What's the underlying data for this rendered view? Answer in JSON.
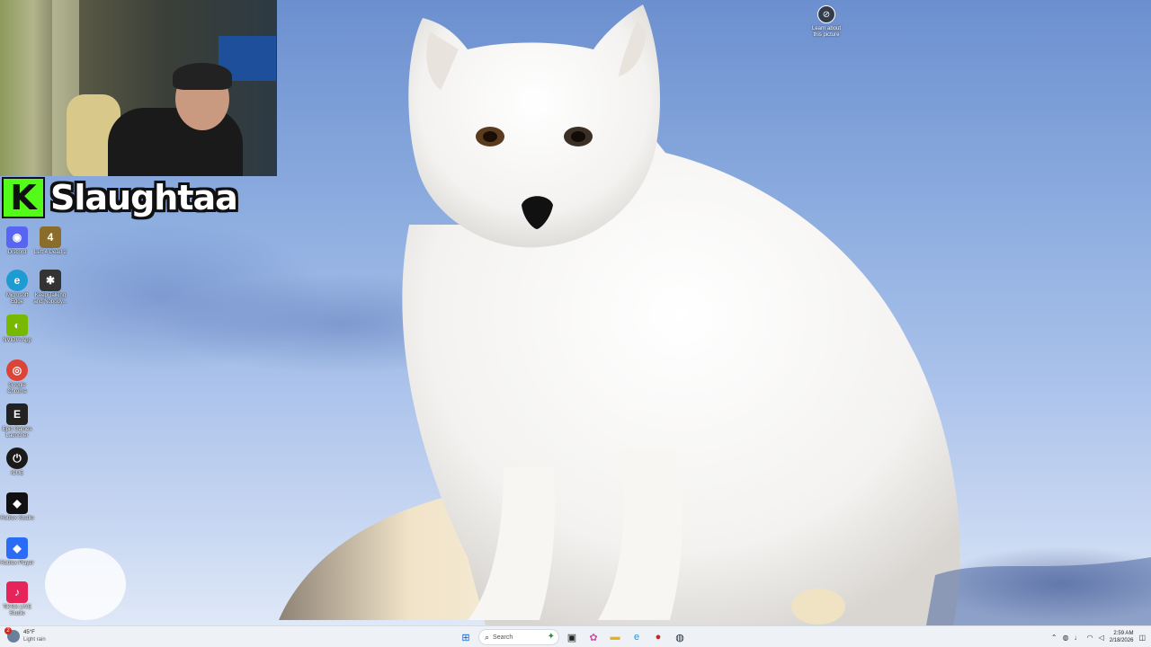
{
  "overlay": {
    "streamer_name": "Slaughtaa",
    "kick_logo_letter": "K",
    "kick_color": "#53fc18"
  },
  "desktop": {
    "learn_about_picture": {
      "label": "Learn about this picture",
      "icon": "camera-icon"
    },
    "icons": [
      {
        "name": "discord-icon",
        "label": "Discord",
        "color": "#5865f2",
        "glyph": "◉"
      },
      {
        "name": "left4dead2-icon",
        "label": "Left 4 Dead 2",
        "color": "#8a6d2a",
        "glyph": "4"
      },
      {
        "name": "edge-icon",
        "label": "Microsoft Edge",
        "color": "#1f9bd4",
        "glyph": "e"
      },
      {
        "name": "keep-talking-icon",
        "label": "Keep Talking and Nobody...",
        "color": "#333333",
        "glyph": "✱"
      },
      {
        "name": "nvidia-icon",
        "label": "NVIDIA App",
        "color": "#76b900",
        "glyph": "◐"
      },
      {
        "name": "chrome-icon",
        "label": "Google Chrome",
        "color": "#db4437",
        "glyph": "◎"
      },
      {
        "name": "epic-games-icon",
        "label": "Epic Games Launcher",
        "color": "#222222",
        "glyph": "E"
      },
      {
        "name": "icue-icon",
        "label": "iCUE",
        "color": "#1a1a1a",
        "glyph": "⏻"
      },
      {
        "name": "roblox-studio-icon",
        "label": "Roblox Studio",
        "color": "#111111",
        "glyph": "◆"
      },
      {
        "name": "roblox-player-icon",
        "label": "Roblox Player",
        "color": "#2b6cf6",
        "glyph": "◆"
      },
      {
        "name": "tiktok-live-icon",
        "label": "TikTok LIVE Studio",
        "color": "#e6245a",
        "glyph": "♪"
      }
    ]
  },
  "taskbar": {
    "weather": {
      "temp": "45°F",
      "condition": "Light rain",
      "badge": "2"
    },
    "search_placeholder": "Search",
    "apps": [
      {
        "name": "start-icon",
        "glyph": "⊞",
        "color": "#0a64d6"
      },
      {
        "name": "task-view-icon",
        "glyph": "▣",
        "color": "#222222"
      },
      {
        "name": "copilot-icon",
        "glyph": "✿",
        "color": "#d64aa0"
      },
      {
        "name": "file-explorer-icon",
        "glyph": "▬",
        "color": "#e8b11c"
      },
      {
        "name": "edge-taskbar-icon",
        "glyph": "e",
        "color": "#1f9bd4"
      },
      {
        "name": "record-app-icon",
        "glyph": "●",
        "color": "#c62828"
      },
      {
        "name": "steam-icon",
        "glyph": "◍",
        "color": "#1b2838"
      }
    ],
    "clock": {
      "time": "2:59 AM",
      "date": "2/18/2026"
    }
  }
}
